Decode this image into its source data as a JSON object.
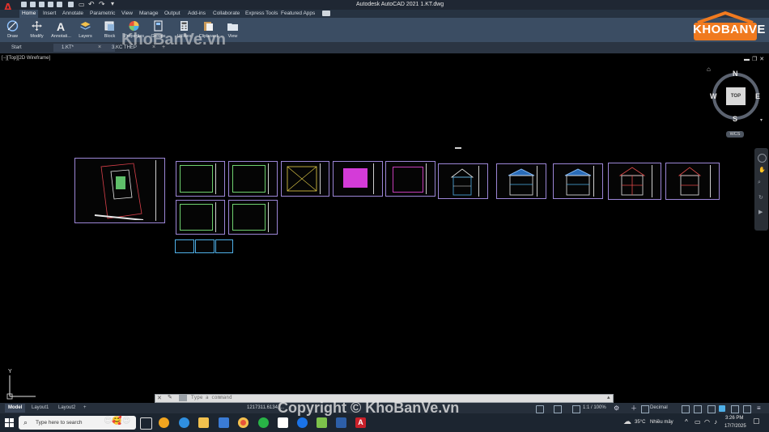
{
  "app": {
    "title": "Autodesk AutoCAD 2021   1.KT.dwg",
    "logo_letter": "A"
  },
  "ribbon": {
    "tabs": [
      "Home",
      "Insert",
      "Annotate",
      "Parametric",
      "View",
      "Manage",
      "Output",
      "Add-ins",
      "Collaborate",
      "Express Tools",
      "Featured Apps"
    ],
    "active_tab": "Home",
    "panels": [
      "Draw",
      "Modify",
      "Annotati...",
      "Layers",
      "Block",
      "Properties",
      "Groups",
      "Utilities",
      "Clipboard",
      "View"
    ]
  },
  "file_tabs": [
    {
      "label": "Start",
      "active": false
    },
    {
      "label": "1.KT*",
      "active": true
    },
    {
      "label": "3.KC THÉP",
      "active": false
    }
  ],
  "viewport": {
    "label": "[−][Top][2D Wireframe]",
    "viewcube": {
      "top_face": "TOP",
      "north": "N",
      "south": "S",
      "east": "E",
      "west": "W",
      "ucs_badge": "WCS"
    },
    "ucs_y_label": "Y"
  },
  "command_line": {
    "placeholder": "Type a command"
  },
  "status_bar": {
    "layout_tabs": [
      "Model",
      "Layout1",
      "Layout2"
    ],
    "active_layout": "Model",
    "add_tab": "+",
    "coordinates": "1217311.6134, ...",
    "scale": "1:1 / 100%",
    "units": "Decimal"
  },
  "taskbar": {
    "search_placeholder": "Type here to search",
    "weather_temp": "35°C",
    "weather_text": "Nhiều mây",
    "time": "3:26 PM",
    "date": "17/7/2025"
  },
  "watermark": {
    "top": "KhoBanVe.vn",
    "bottom": "Copyright © KhoBanVe.vn",
    "brand": "KHOBANVE"
  },
  "colors": {
    "ribbon": "#3b4d63",
    "titlebar": "#1f2733",
    "sheet_border": "#9c86d6",
    "brand_orange": "#f07a1f"
  }
}
